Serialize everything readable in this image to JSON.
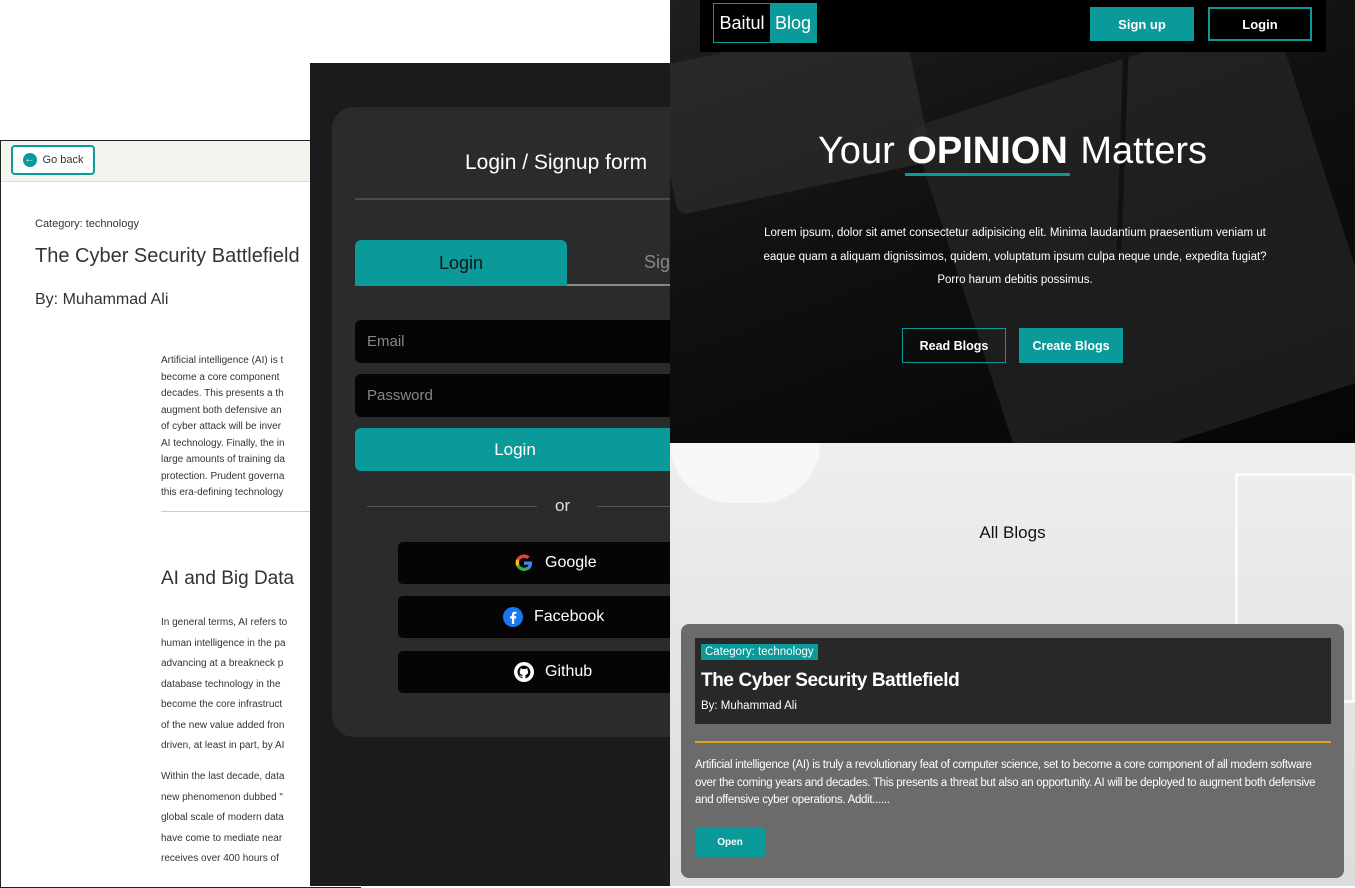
{
  "article_page": {
    "go_back": "Go back",
    "category": "Category: technology",
    "title": "The Cyber Security Battlefield",
    "author": "By: Muhammad Ali",
    "intro_lines": [
      "Artificial intelligence (AI) is t",
      "become a core component",
      "decades. This presents a th",
      "augment both defensive an",
      "of cyber attack will be inver",
      "AI technology. Finally, the in",
      "large amounts of training da",
      "protection. Prudent governa",
      "this era-defining technology"
    ],
    "section_heading": "AI and Big Data",
    "section_lines_a": [
      "In general terms, AI refers to",
      "human intelligence in the pa",
      "advancing at a breakneck p",
      "database technology in the",
      "become the core infrastruct",
      "of the new value added fron",
      "driven, at least in part, by AI"
    ],
    "section_lines_b": [
      "Within the last decade, data",
      "new phenomenon dubbed \"",
      "global scale of modern data",
      "have come to mediate near",
      "receives over 400 hours of"
    ]
  },
  "login_form": {
    "title": "Login / Signup form",
    "tab_login": "Login",
    "tab_signup": "Sig",
    "email_placeholder": "Email",
    "password_placeholder": "Password",
    "login_button": "Login",
    "or_text": "or",
    "google_label": "Google",
    "facebook_label": "Facebook",
    "github_label": "Github"
  },
  "landing": {
    "logo_part1": "Baitul",
    "logo_part2": "Blog",
    "nav_signup": "Sign up",
    "nav_login": "Login",
    "headline_pre": "Your",
    "headline_em": "OPINION",
    "headline_post": "Matters",
    "lorem": "Lorem ipsum, dolor sit amet consectetur adipisicing elit. Minima laudantium praesentium veniam ut eaque quam a aliquam dignissimos, quidem, voluptatum ipsum culpa neque unde, expedita fugiat? Porro harum debitis possimus.",
    "read_blogs": "Read Blogs",
    "create_blogs": "Create Blogs",
    "all_blogs": "All Blogs",
    "card": {
      "category": "Category: technology",
      "title": "The Cyber Security Battlefield",
      "author": "By: Muhammad Ali",
      "excerpt": "Artificial intelligence (AI) is truly a revolutionary feat of computer science, set to become a core component of all modern software over the coming years and decades. This presents a threat but also an opportunity. AI will be deployed to augment both defensive and offensive cyber operations. Addit......",
      "open": "Open"
    }
  },
  "colors": {
    "accent": "#0a9a9a",
    "card_divider": "#e5a11a"
  }
}
